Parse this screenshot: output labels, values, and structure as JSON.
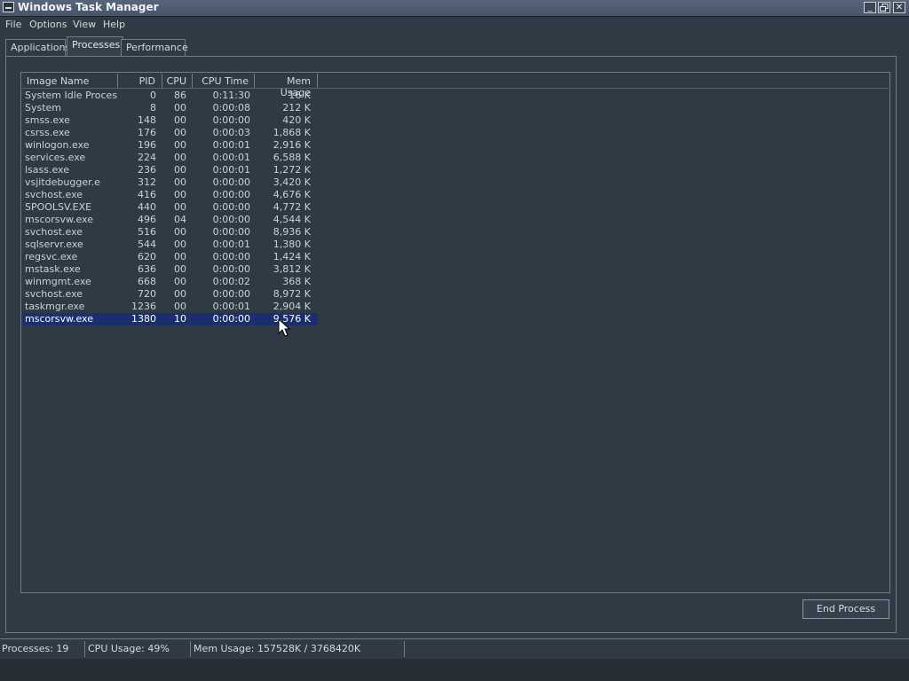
{
  "window": {
    "title": "Windows Task Manager"
  },
  "menu": [
    "File",
    "Options",
    "View",
    "Help"
  ],
  "tabs": [
    "Applications",
    "Processes",
    "Performance"
  ],
  "active_tab": "Processes",
  "columns": [
    "Image Name",
    "PID",
    "CPU",
    "CPU Time",
    "Mem Usage"
  ],
  "processes": [
    {
      "name": "System Idle Process",
      "pid": "0",
      "cpu": "86",
      "time": "0:11:30",
      "mem": "16 K"
    },
    {
      "name": "System",
      "pid": "8",
      "cpu": "00",
      "time": "0:00:08",
      "mem": "212 K"
    },
    {
      "name": "smss.exe",
      "pid": "148",
      "cpu": "00",
      "time": "0:00:00",
      "mem": "420 K"
    },
    {
      "name": "csrss.exe",
      "pid": "176",
      "cpu": "00",
      "time": "0:00:03",
      "mem": "1,868 K"
    },
    {
      "name": "winlogon.exe",
      "pid": "196",
      "cpu": "00",
      "time": "0:00:01",
      "mem": "2,916 K"
    },
    {
      "name": "services.exe",
      "pid": "224",
      "cpu": "00",
      "time": "0:00:01",
      "mem": "6,588 K"
    },
    {
      "name": "lsass.exe",
      "pid": "236",
      "cpu": "00",
      "time": "0:00:01",
      "mem": "1,272 K"
    },
    {
      "name": "vsjitdebugger.e",
      "pid": "312",
      "cpu": "00",
      "time": "0:00:00",
      "mem": "3,420 K"
    },
    {
      "name": "svchost.exe",
      "pid": "416",
      "cpu": "00",
      "time": "0:00:00",
      "mem": "4,676 K"
    },
    {
      "name": "SPOOLSV.EXE",
      "pid": "440",
      "cpu": "00",
      "time": "0:00:00",
      "mem": "4,772 K"
    },
    {
      "name": "mscorsvw.exe",
      "pid": "496",
      "cpu": "04",
      "time": "0:00:00",
      "mem": "4,544 K"
    },
    {
      "name": "svchost.exe",
      "pid": "516",
      "cpu": "00",
      "time": "0:00:00",
      "mem": "8,936 K"
    },
    {
      "name": "sqlservr.exe",
      "pid": "544",
      "cpu": "00",
      "time": "0:00:01",
      "mem": "1,380 K"
    },
    {
      "name": "regsvc.exe",
      "pid": "620",
      "cpu": "00",
      "time": "0:00:00",
      "mem": "1,424 K"
    },
    {
      "name": "mstask.exe",
      "pid": "636",
      "cpu": "00",
      "time": "0:00:00",
      "mem": "3,812 K"
    },
    {
      "name": "winmgmt.exe",
      "pid": "668",
      "cpu": "00",
      "time": "0:00:02",
      "mem": "368 K"
    },
    {
      "name": "svchost.exe",
      "pid": "720",
      "cpu": "00",
      "time": "0:00:00",
      "mem": "8,972 K"
    },
    {
      "name": "taskmgr.exe",
      "pid": "1236",
      "cpu": "00",
      "time": "0:00:01",
      "mem": "2,904 K"
    },
    {
      "name": "mscorsvw.exe",
      "pid": "1380",
      "cpu": "10",
      "time": "0:00:00",
      "mem": "9,576 K",
      "selected": true
    }
  ],
  "buttons": {
    "end_process": "End Process"
  },
  "status": {
    "processes": "Processes: 19",
    "cpu": "CPU Usage: 49%",
    "mem": "Mem Usage: 157528K / 3768420K"
  },
  "icons": {
    "app": "task-manager-icon",
    "minimize": "minimize-icon",
    "restore": "restore-icon",
    "close": "close-icon",
    "cursor": "mouse-pointer-icon"
  },
  "colors": {
    "background": "#2f3a44",
    "titlebar": "#4e5d72",
    "selection": "#1b2f6e",
    "border": "#6e7b88"
  }
}
